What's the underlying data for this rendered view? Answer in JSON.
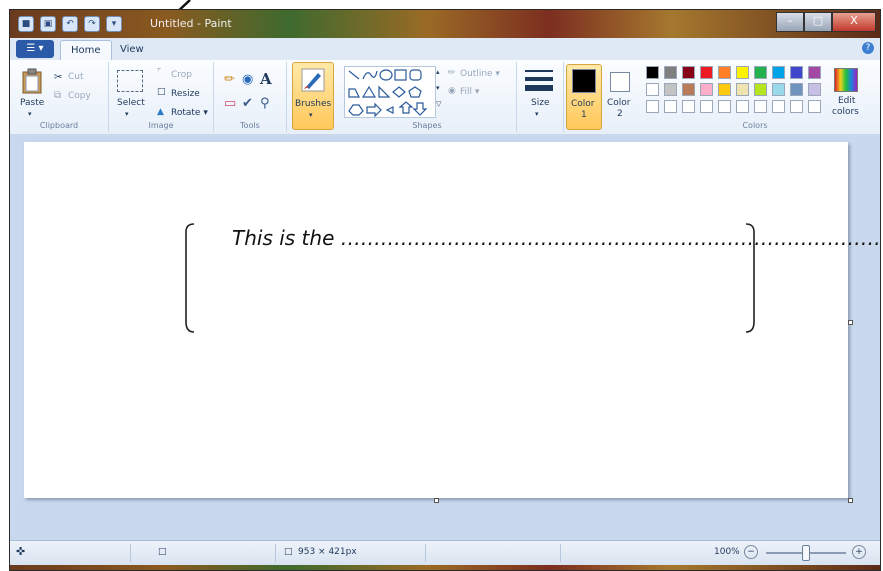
{
  "window": {
    "title": "Untitled - Paint",
    "quick_access": [
      "save-icon",
      "undo-icon",
      "redo-icon",
      "dropdown-icon"
    ],
    "controls": {
      "minimize": "–",
      "maximize": "□",
      "close": "X"
    }
  },
  "tabs": {
    "file_menu": "☰ ▾",
    "items": [
      {
        "label": "Home",
        "active": true
      },
      {
        "label": "View",
        "active": false
      }
    ],
    "help": "?"
  },
  "ribbon": {
    "clipboard": {
      "label": "Clipboard",
      "paste": "Paste",
      "cut": "Cut",
      "copy": "Copy"
    },
    "image": {
      "label": "Image",
      "select": "Select",
      "crop": "Crop",
      "resize": "Resize",
      "rotate": "Rotate ▾"
    },
    "tools": {
      "label": "Tools"
    },
    "brushes": {
      "label": "Brushes"
    },
    "shapes": {
      "label": "Shapes",
      "outline": "Outline ▾",
      "fill": "Fill ▾"
    },
    "size": {
      "label": "Size"
    },
    "color1": {
      "label": "Color",
      "sub": "1",
      "value": "#000000"
    },
    "color2": {
      "label": "Color",
      "sub": "2",
      "value": "#ffffff"
    },
    "colors": {
      "label": "Colors",
      "edit": "Edit",
      "edit2": "colors",
      "row1": [
        "#000000",
        "#7f7f7f",
        "#880015",
        "#ed1c24",
        "#ff7f27",
        "#fff200",
        "#22b14c",
        "#00a2e8",
        "#3f48cc",
        "#a349a4"
      ],
      "row2": [
        "#ffffff",
        "#c3c3c3",
        "#b97a57",
        "#ffaec9",
        "#ffc90e",
        "#efe4b0",
        "#b5e61d",
        "#99d9ea",
        "#7092be",
        "#c8bfe7"
      ],
      "row3": [
        "#ffffff",
        "#ffffff",
        "#ffffff",
        "#ffffff",
        "#ffffff",
        "#ffffff",
        "#ffffff",
        "#ffffff",
        "#ffffff",
        "#ffffff"
      ]
    }
  },
  "canvas": {
    "text": "This is the ……………………………………………………………………………………."
  },
  "statusbar": {
    "dimensions": "953 × 421px",
    "zoom": "100%",
    "zoom_out": "−",
    "zoom_in": "+"
  }
}
